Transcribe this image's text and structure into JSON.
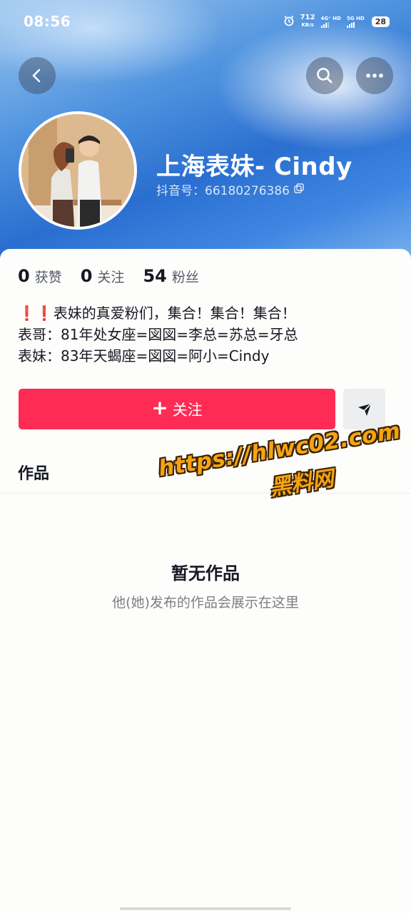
{
  "status_bar": {
    "time": "08:56",
    "net_speed_value": "712",
    "net_speed_unit": "KB/s",
    "sim1_label": "4G⁺ HD",
    "sim2_label": "5G HD",
    "battery": "28"
  },
  "nav": {
    "back_icon": "chevron-left-icon",
    "search_icon": "search-icon",
    "more_icon": "more-horizontal-icon"
  },
  "profile": {
    "name": "上海表妹- Cindy",
    "id_label": "抖音号：",
    "id_value": "66180276386",
    "copy_icon": "copy-icon"
  },
  "stats": [
    {
      "value": "0",
      "label": "获赞"
    },
    {
      "value": "0",
      "label": "关注"
    },
    {
      "value": "54",
      "label": "粉丝"
    }
  ],
  "bio": {
    "line1_prefix": "❗❗",
    "line1": "表妹的真爱粉们，集合！集合！集合！",
    "line2": "表哥：81年处女座=図図=李总=苏总=牙总",
    "line3": "表妹：83年天蝎座=図図=阿小=Cindy"
  },
  "actions": {
    "follow_plus": "+",
    "follow_label": "关注",
    "share_icon": "send-icon"
  },
  "tabs": {
    "works": "作品"
  },
  "watermark": {
    "url": "https://hlwc02.com",
    "sub": "黑料网"
  },
  "empty_state": {
    "title": "暂无作品",
    "subtitle": "他(她)发布的作品会展示在这里"
  },
  "colors": {
    "accent": "#fe2c55",
    "header_blue": "#2a6fd0",
    "watermark": "#f6a313"
  }
}
